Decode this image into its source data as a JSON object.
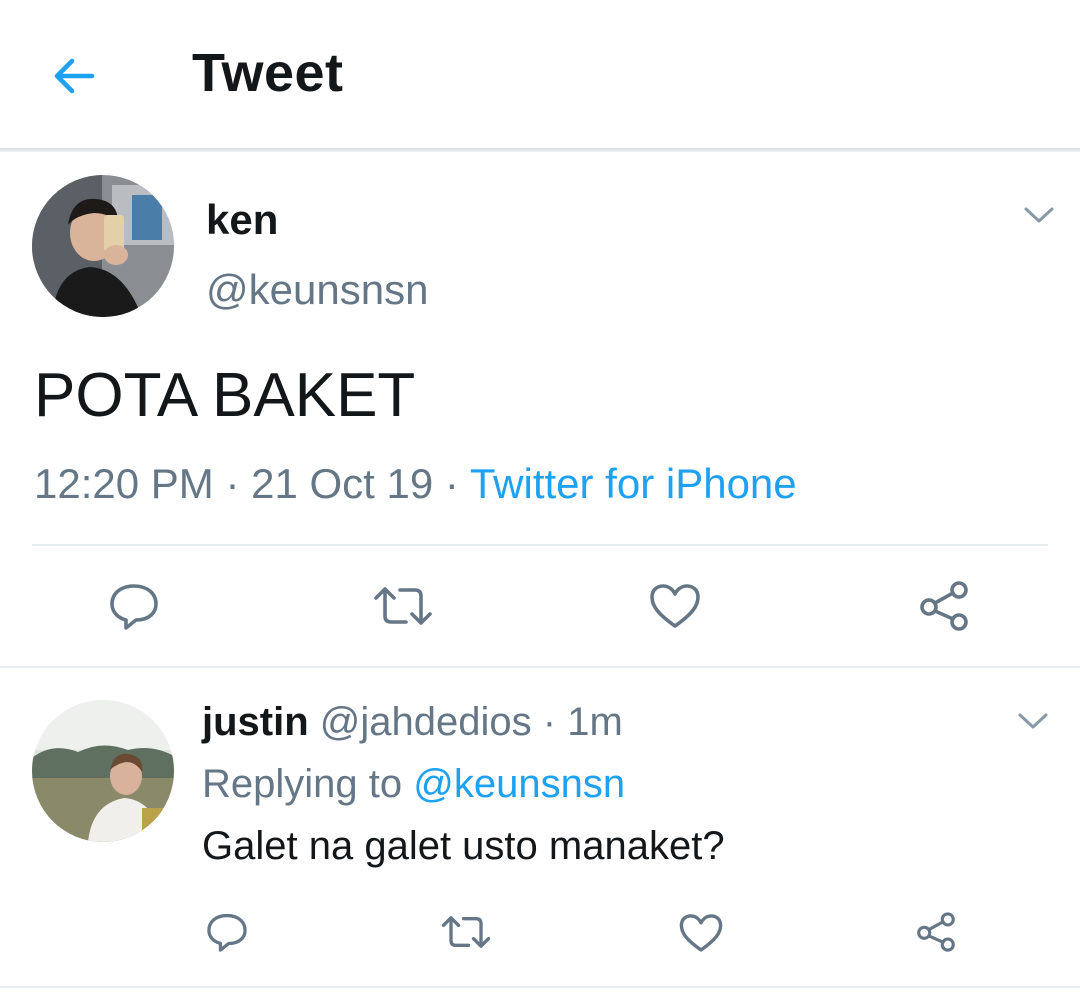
{
  "header": {
    "title": "Tweet",
    "back_icon": "arrow-left-icon"
  },
  "tweet": {
    "name": "ken",
    "handle": "@keunsnsn",
    "text": "POTA BAKET",
    "time": "12:20 PM",
    "date": "21 Oct 19",
    "separator": "·",
    "source": "Twitter for iPhone"
  },
  "reply": {
    "name": "justin",
    "handle": "@jahdedios",
    "separator": "·",
    "age": "1m",
    "replying_prefix": "Replying to",
    "replying_to": "@keunsnsn",
    "text": "Galet na galet usto manaket?"
  },
  "actions": [
    "reply-icon",
    "retweet-icon",
    "like-icon",
    "share-icon"
  ],
  "colors": {
    "accent": "#1da1f2",
    "muted": "#657786",
    "text": "#14171a",
    "icon": "#657786"
  }
}
